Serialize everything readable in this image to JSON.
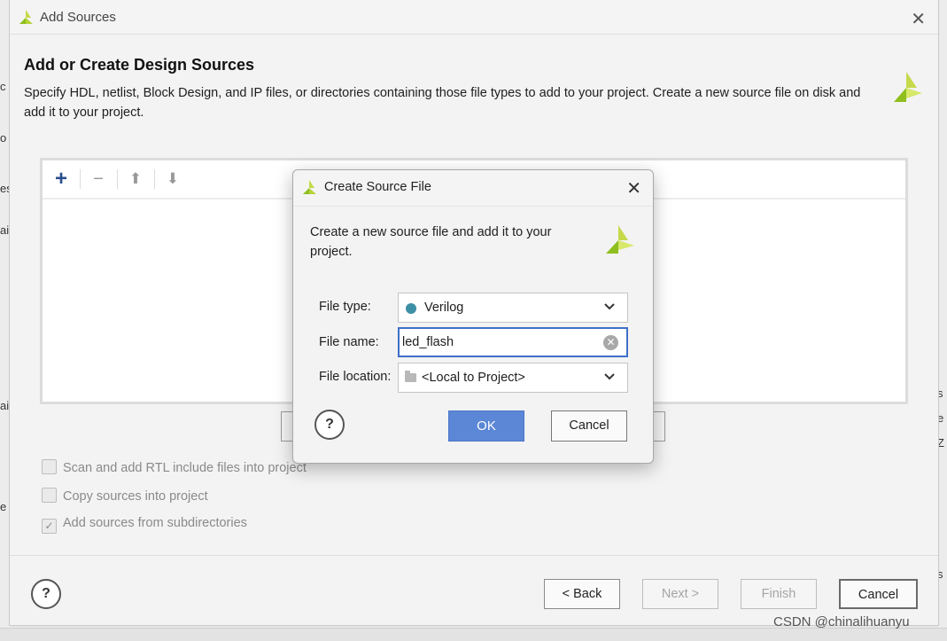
{
  "main_dialog": {
    "title": "Add Sources",
    "heading": "Add or Create Design Sources",
    "description": "Specify HDL, netlist, Block Design, and IP files, or directories containing those file types to add to your project. Create a new source file on disk and add it to your project.",
    "options": [
      {
        "label": "Scan and add RTL include files into project",
        "checked": false,
        "enabled": false
      },
      {
        "label": "Copy sources into project",
        "checked": false,
        "enabled": false
      },
      {
        "label": "Add sources from subdirectories",
        "checked": true,
        "enabled": false
      }
    ],
    "buttons": {
      "help": "?",
      "back": "< Back",
      "next": "Next >",
      "finish": "Finish",
      "cancel": "Cancel"
    }
  },
  "create_source_dialog": {
    "title": "Create Source File",
    "description": "Create a new source file and add it to your project.",
    "file_type_label": "File type:",
    "file_type_value": "Verilog",
    "file_name_label": "File name:",
    "file_name_value": "led_flash",
    "file_location_label": "File location:",
    "file_location_value": "<Local to Project>",
    "help": "?",
    "ok": "OK",
    "cancel": "Cancel"
  },
  "watermark": "CSDN @chinalihuanyu",
  "colors": {
    "logo_green": "#8fbf1e",
    "ok_blue": "#5b87d6",
    "verilog_dot": "#3d8fa6",
    "active_border": "#3f6fc8"
  }
}
